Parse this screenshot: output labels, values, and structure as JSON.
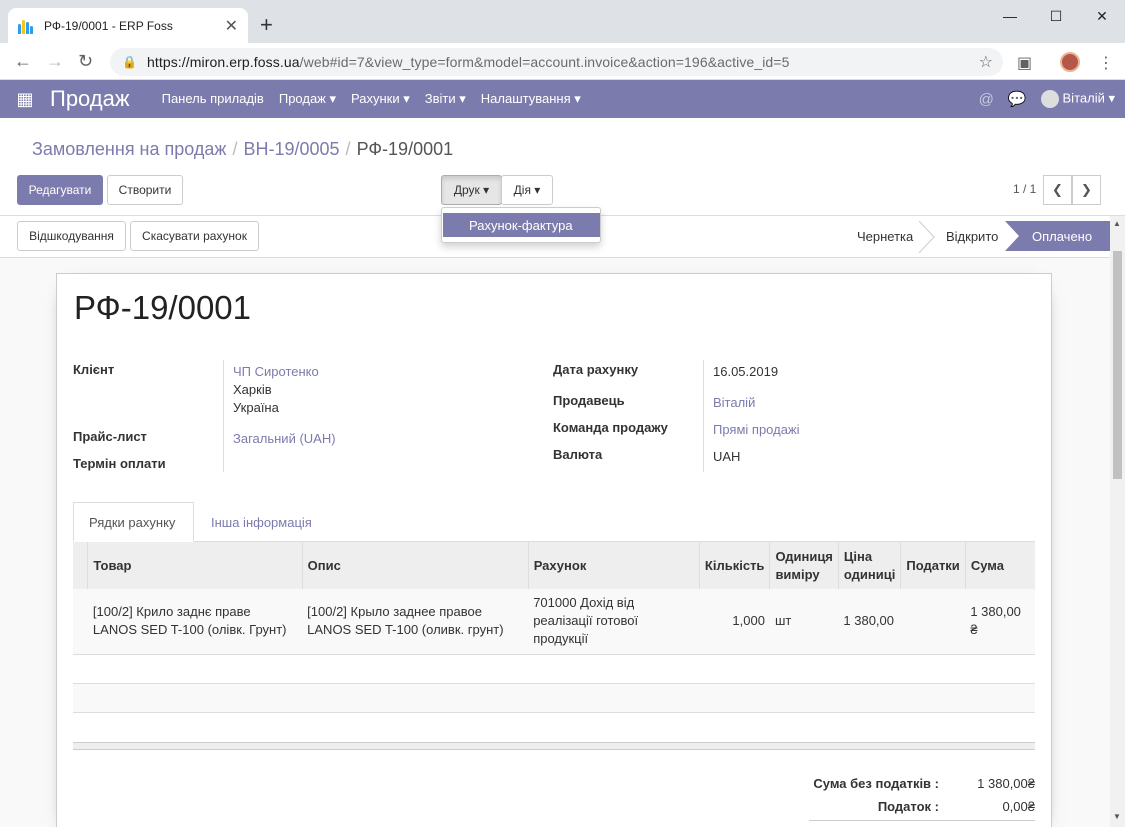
{
  "browser": {
    "tab_title": "РФ-19/0001 - ERP Foss",
    "url_host": "https://miron.erp.foss.ua",
    "url_path": "/web#id=7&view_type=form&model=account.invoice&action=196&active_id=5"
  },
  "navbar": {
    "brand": "Продаж",
    "menu": [
      "Панель приладів",
      "Продаж ▾",
      "Рахунки ▾",
      "Звіти ▾",
      "Налаштування ▾"
    ],
    "user": "Віталій ▾"
  },
  "breadcrumb": {
    "level1": "Замовлення на продаж",
    "level2": "ВН-19/0005",
    "current": "РФ-19/0001"
  },
  "toolbar": {
    "edit": "Редагувати",
    "create": "Створити",
    "print": "Друк ▾",
    "action": "Дія ▾",
    "pager": "1 / 1",
    "print_item": "Рахунок-фактура"
  },
  "statusbar": {
    "reconcile": "Відшкодування",
    "cancel": "Скасувати рахунок",
    "stages": [
      "Чернетка",
      "Відкрито",
      "Оплачено"
    ],
    "active_stage": "Оплачено"
  },
  "invoice": {
    "number": "РФ-19/0001",
    "labels": {
      "client": "Клієнт",
      "pricelist": "Прайс-лист",
      "payment_term": "Термін оплати",
      "date": "Дата рахунку",
      "salesperson": "Продавець",
      "team": "Команда продажу",
      "currency": "Валюта"
    },
    "client_name": "ЧП Сиротенко",
    "client_city": "Харків",
    "client_country": "Україна",
    "pricelist": "Загальний (UAH)",
    "date": "16.05.2019",
    "salesperson": "Віталій",
    "team": "Прямі продажі",
    "currency": "UAH"
  },
  "tabs": [
    "Рядки рахунку",
    "Інша інформація"
  ],
  "lines": {
    "headers": [
      "Товар",
      "Опис",
      "Рахунок",
      "Кількість",
      "Одиниця виміру",
      "Ціна одиниці",
      "Податки",
      "Сума"
    ],
    "rows": [
      {
        "product": "[100/2] Крило заднє праве LANOS SED T-100 (олівк. Грунт)",
        "description": "[100/2] Крыло заднее правое LANOS SED T-100 (оливк. грунт)",
        "account": "701000 Дохід від реалізації готової продукції",
        "qty": "1,000",
        "uom": "шт",
        "price": "1 380,00",
        "taxes": "",
        "amount": "1 380,00 ₴"
      }
    ]
  },
  "totals": {
    "untaxed_label": "Сума без податків :",
    "untaxed": "1 380,00₴",
    "tax_label": "Податок :",
    "tax": "0,00₴"
  },
  "colors": {
    "accent": "#7c7bad"
  }
}
